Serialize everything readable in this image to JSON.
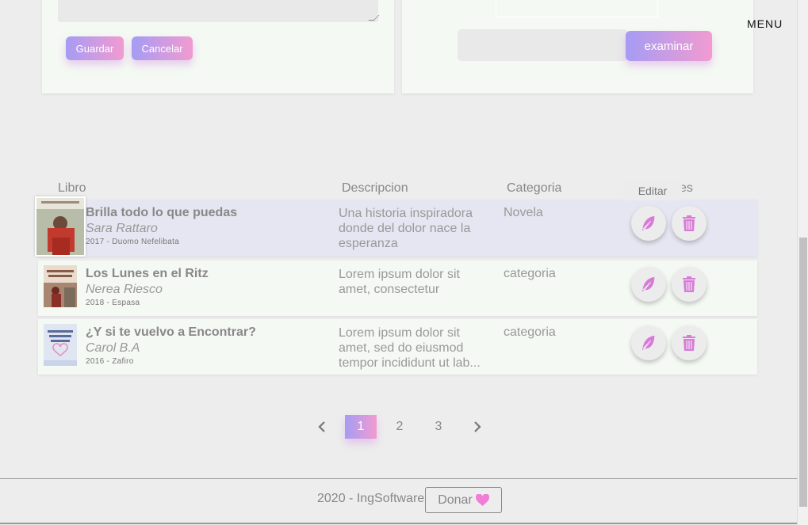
{
  "header": {
    "menu_label": "MENU"
  },
  "form": {
    "save_label": "Guardar",
    "cancel_label": "Cancelar",
    "browse_label": "examinar"
  },
  "table": {
    "columns": [
      "Libro",
      "Descripcion",
      "Categoria",
      "es"
    ],
    "tooltip": "Editar",
    "rows": [
      {
        "title": "Brilla todo lo que puedas",
        "author": "Sara Rattaro",
        "meta": "2017 - Duomo Nefelibata",
        "description": "Una historia inspiradora donde del dolor nace la esperanza",
        "category": "Novela"
      },
      {
        "title": "Los Lunes en el Ritz",
        "author": "Nerea Riesco",
        "meta": "2018 - Espasa",
        "description": "Lorem ipsum dolor sit amet, consectetur",
        "category": "categoria"
      },
      {
        "title": "¿Y si te vuelvo a Encontrar?",
        "author": "Carol B.A",
        "meta": "2016 - Zafiro",
        "description": "Lorem ipsum dolor sit amet, sed do eiusmod tempor incididunt ut lab...",
        "category": "categoria"
      }
    ]
  },
  "pagination": {
    "pages": [
      "1",
      "2",
      "3"
    ],
    "current": "1"
  },
  "footer": {
    "text": "2020 - IngSoftware",
    "donate_label": "Donar"
  },
  "colors": {
    "accent_start": "#a59cf4",
    "accent_end": "#f29bd0",
    "icon": "#d97ad8"
  }
}
